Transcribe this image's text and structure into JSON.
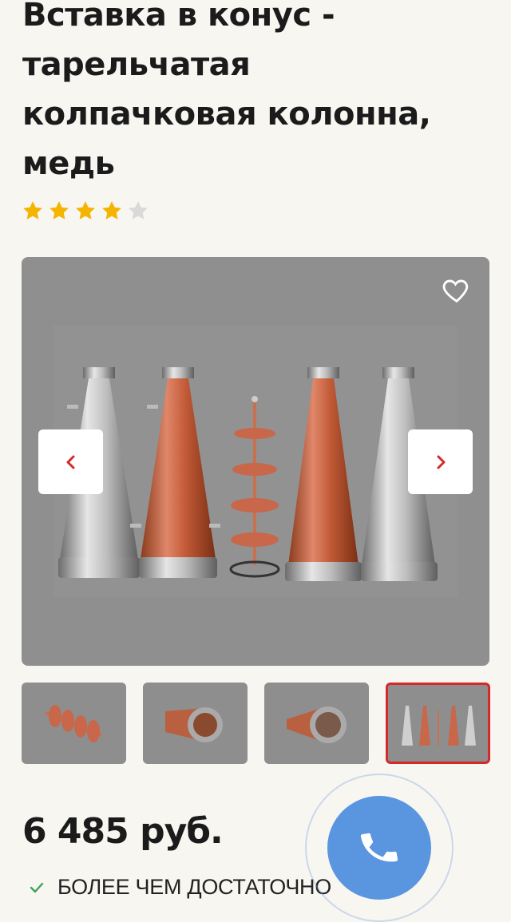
{
  "product": {
    "title": "Вставка в конус - тарельчатая колпачковая колонна, медь",
    "rating": 4,
    "rating_max": 5,
    "price": "6 485 руб.",
    "stock_status": "БОЛЕЕ ЧЕМ ДОСТАТОЧНО"
  },
  "gallery": {
    "thumbnail_count": 4,
    "active_thumbnail": 4
  },
  "colors": {
    "background": "#f7f6f1",
    "star_filled": "#f5b400",
    "star_empty": "#d9d9d9",
    "active_border": "#d32a2a",
    "call_button": "#5a95e0",
    "check": "#3aa655",
    "arrow": "#d32a2a"
  },
  "icons": [
    "heart-icon",
    "chevron-left-icon",
    "chevron-right-icon",
    "check-icon",
    "phone-icon",
    "star-icon"
  ]
}
